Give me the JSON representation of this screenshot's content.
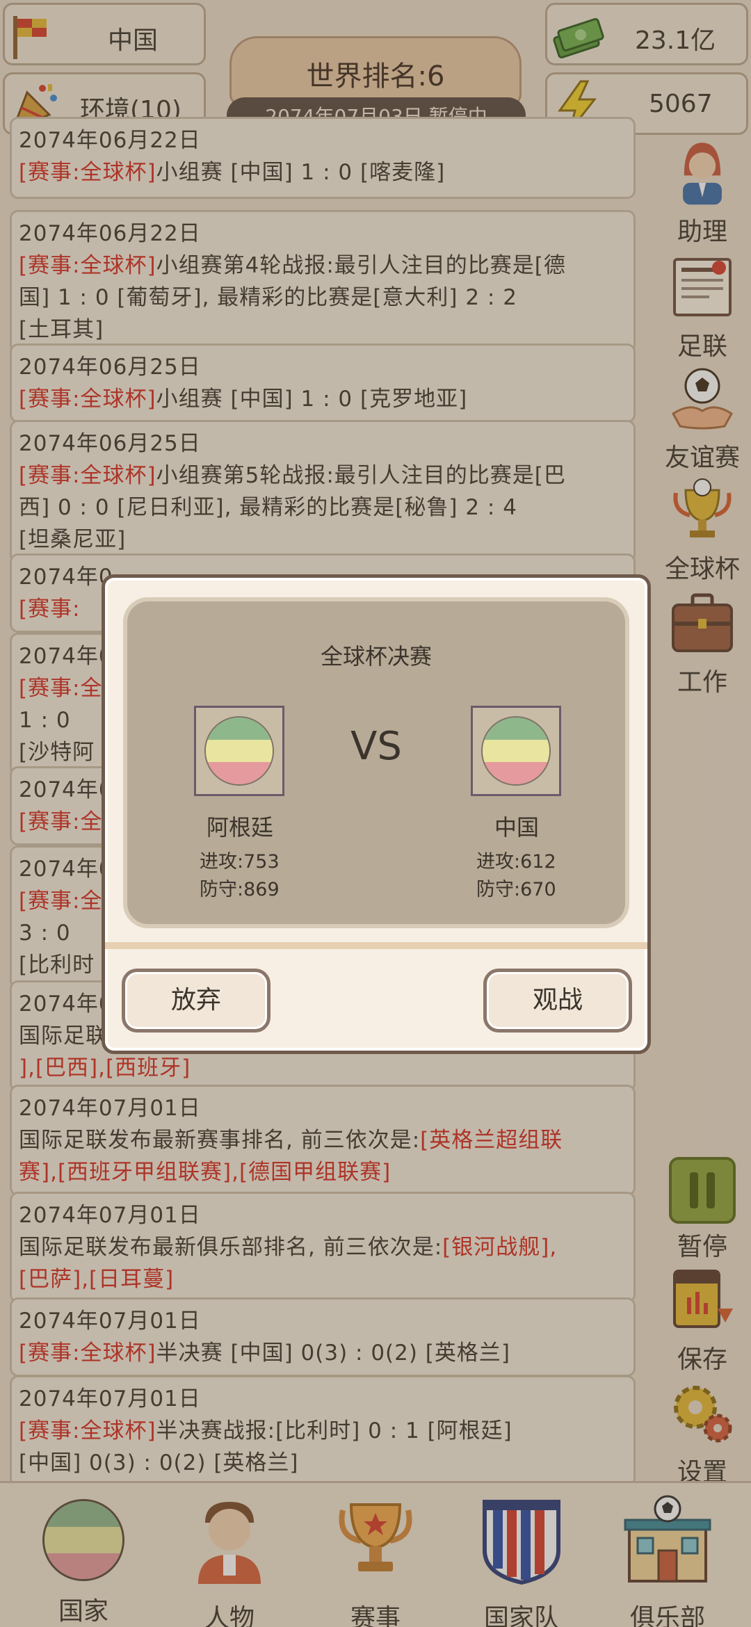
{
  "top": {
    "country_label": "中国",
    "env_label": "环境(10)",
    "money": "23.1亿",
    "energy": "5067",
    "rank": "世界排名:6",
    "date_status": "2074年07月03日  暂停中"
  },
  "feed": [
    {
      "date": "2074年06月22日",
      "lines": [
        [
          {
            "t": "[赛事:全球杯]",
            "red": true
          },
          {
            "t": "小组赛 [中国] 1 : 0 [喀麦隆]"
          }
        ]
      ]
    },
    {
      "date": "2074年06月22日",
      "lines": [
        [
          {
            "t": "[赛事:全球杯]",
            "red": true
          },
          {
            "t": "小组赛第4轮战报:最引人注目的比赛是[德"
          }
        ],
        [
          {
            "t": "国] 1 : 0 [葡萄牙], 最精彩的比赛是[意大利] 2 : 2"
          }
        ],
        [
          {
            "t": "[土耳其]"
          }
        ]
      ]
    },
    {
      "date": "2074年06月25日",
      "lines": [
        [
          {
            "t": "[赛事:全球杯]",
            "red": true
          },
          {
            "t": "小组赛 [中国] 1 : 0 [克罗地亚]"
          }
        ]
      ]
    },
    {
      "date": "2074年06月25日",
      "lines": [
        [
          {
            "t": "[赛事:全球杯]",
            "red": true
          },
          {
            "t": "小组赛第5轮战报:最引人注目的比赛是[巴"
          }
        ],
        [
          {
            "t": "西] 0 : 0 [尼日利亚], 最精彩的比赛是[秘鲁] 2 : 4"
          }
        ],
        [
          {
            "t": "[坦桑尼亚]"
          }
        ]
      ]
    },
    {
      "date": "2074年0",
      "lines": [
        [
          {
            "t": "[赛事:",
            "red": true
          }
        ]
      ]
    },
    {
      "date": "2074年0",
      "lines": [
        [
          {
            "t": "[赛事:全",
            "red": true
          }
        ],
        [
          {
            "t": "1 : 0"
          }
        ],
        [
          {
            "t": "[沙特阿"
          }
        ]
      ]
    },
    {
      "date": "2074年0",
      "lines": [
        [
          {
            "t": "[赛事:全",
            "red": true
          }
        ]
      ]
    },
    {
      "date": "2074年0",
      "lines": [
        [
          {
            "t": "[赛事:全",
            "red": true
          }
        ],
        [
          {
            "t": "3 : 0"
          }
        ],
        [
          {
            "t": "[比利时"
          }
        ]
      ]
    },
    {
      "date": "2074年0",
      "lines": [
        [
          {
            "t": "国际足联"
          }
        ],
        [
          {
            "t": "],[巴西],[西班牙]",
            "red": true
          }
        ]
      ]
    },
    {
      "date": "2074年07月01日",
      "lines": [
        [
          {
            "t": "国际足联发布最新赛事排名, 前三依次是:"
          },
          {
            "t": "[英格兰超组联",
            "red": true
          }
        ],
        [
          {
            "t": "赛],[西班牙甲组联赛],[德国甲组联赛]",
            "red": true
          }
        ]
      ]
    },
    {
      "date": "2074年07月01日",
      "lines": [
        [
          {
            "t": "国际足联发布最新俱乐部排名, 前三依次是:"
          },
          {
            "t": "[银河战舰],",
            "red": true
          }
        ],
        [
          {
            "t": "[巴萨],[日耳蔓]",
            "red": true
          }
        ]
      ]
    },
    {
      "date": "2074年07月01日",
      "lines": [
        [
          {
            "t": "[赛事:全球杯]",
            "red": true
          },
          {
            "t": "半决赛 [中国] 0(3) : 0(2) [英格兰]"
          }
        ]
      ]
    },
    {
      "date": "2074年07月01日",
      "lines": [
        [
          {
            "t": "[赛事:全球杯]",
            "red": true
          },
          {
            "t": "半决赛战报:[比利时] 0 : 1 [阿根廷]"
          }
        ],
        [
          {
            "t": "[中国] 0(3) : 0(2) [英格兰]"
          }
        ]
      ]
    }
  ],
  "sidebar": {
    "assistant": "助理",
    "federation": "足联",
    "friendly": "友谊赛",
    "global_cup": "全球杯",
    "work": "工作",
    "pause": "暂停",
    "save": "保存",
    "settings": "设置"
  },
  "nav": {
    "country": "国家",
    "person": "人物",
    "events": "赛事",
    "national_team": "国家队",
    "club": "俱乐部"
  },
  "dialog": {
    "title": "全球杯决赛",
    "vs": "VS",
    "home": {
      "name": "阿根廷",
      "attack": "进攻:753",
      "defense": "防守:869"
    },
    "away": {
      "name": "中国",
      "attack": "进攻:612",
      "defense": "防守:670"
    },
    "give_up": "放弃",
    "watch": "观战"
  },
  "colors": {
    "accent_red": "#d4291d",
    "flag_top": "#8fb78c",
    "flag_mid": "#e9e4a0",
    "flag_bottom": "#e59a9d",
    "pause_green": "#8ea33b"
  }
}
